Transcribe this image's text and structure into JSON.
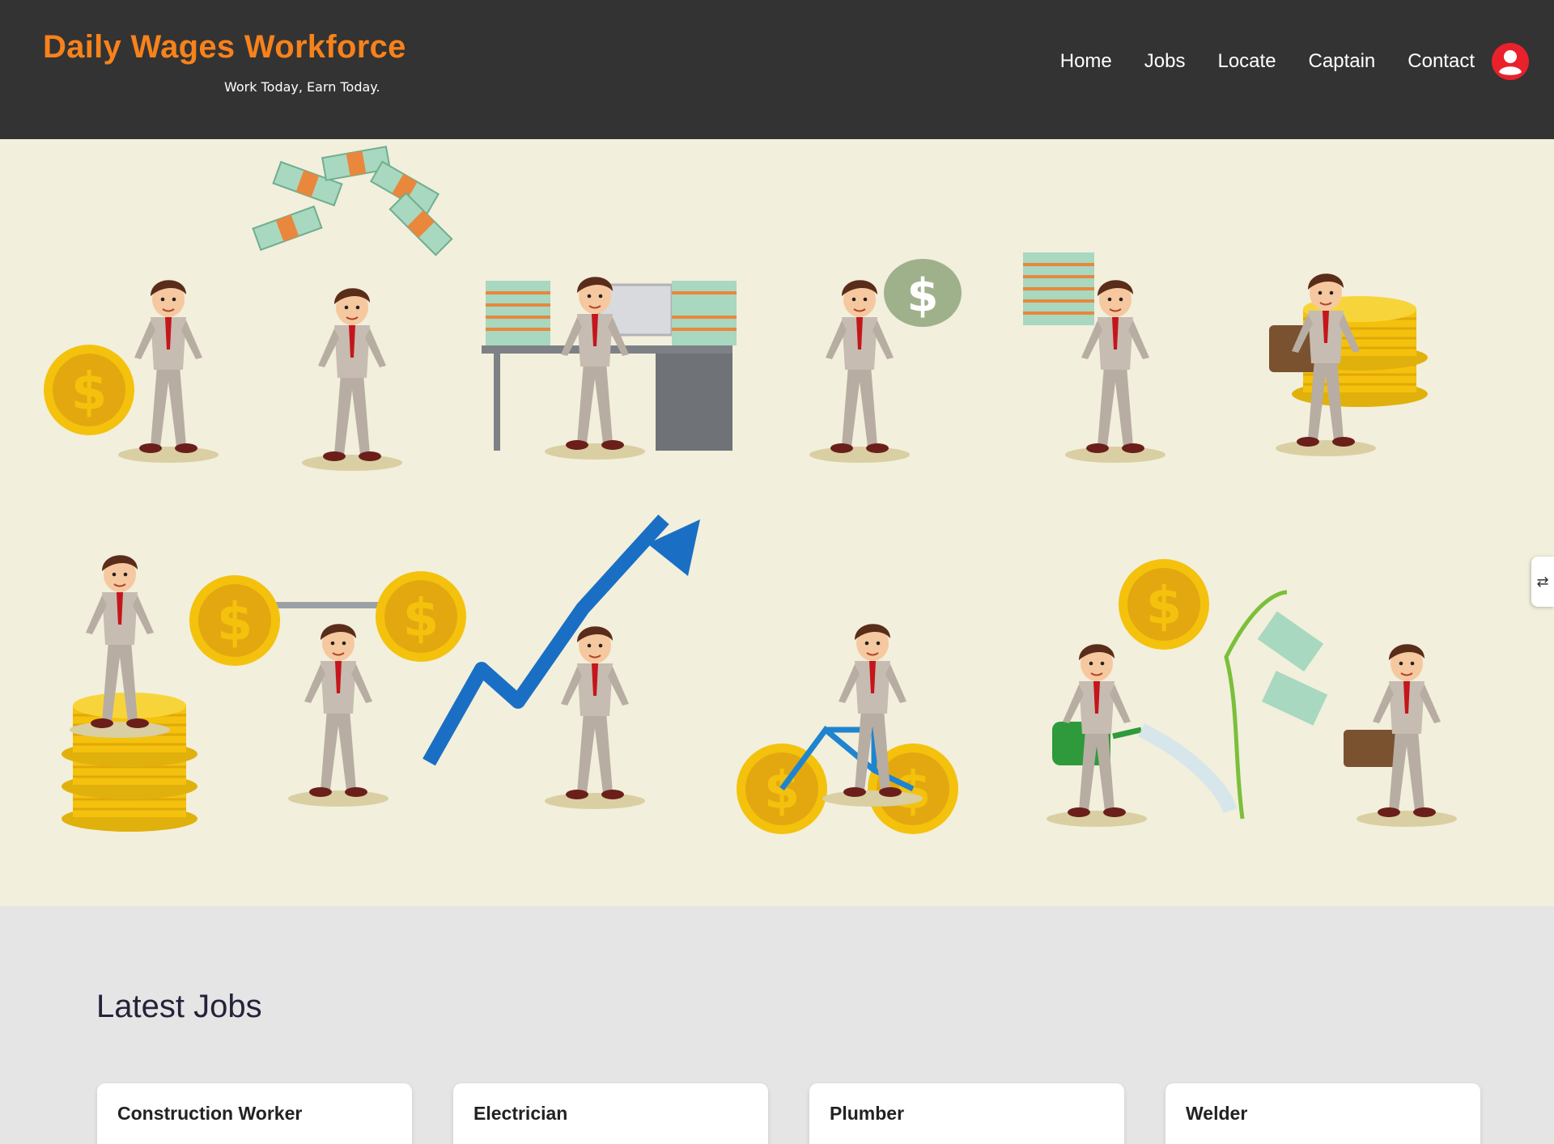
{
  "brand": {
    "title": "Daily Wages Workforce",
    "tagline": "Work Today, Earn Today."
  },
  "nav": {
    "items": [
      "Home",
      "Jobs",
      "Locate",
      "Captain",
      "Contact"
    ],
    "profile_icon": "user-avatar-icon"
  },
  "colors": {
    "header_bg": "#333333",
    "brand_orange": "#f7821b",
    "hero_bg": "#f2efdc",
    "section_bg": "#e5e5e5",
    "profile_red": "#e8212b"
  },
  "hero": {
    "image": "businessman-money-illustrations"
  },
  "jobs": {
    "heading": "Latest Jobs",
    "cards": [
      {
        "title": "Construction Worker"
      },
      {
        "title": "Electrician"
      },
      {
        "title": "Plumber"
      },
      {
        "title": "Welder"
      }
    ]
  },
  "side_tabs": {
    "icon": "expand-icon",
    "glyph": "⇄"
  }
}
